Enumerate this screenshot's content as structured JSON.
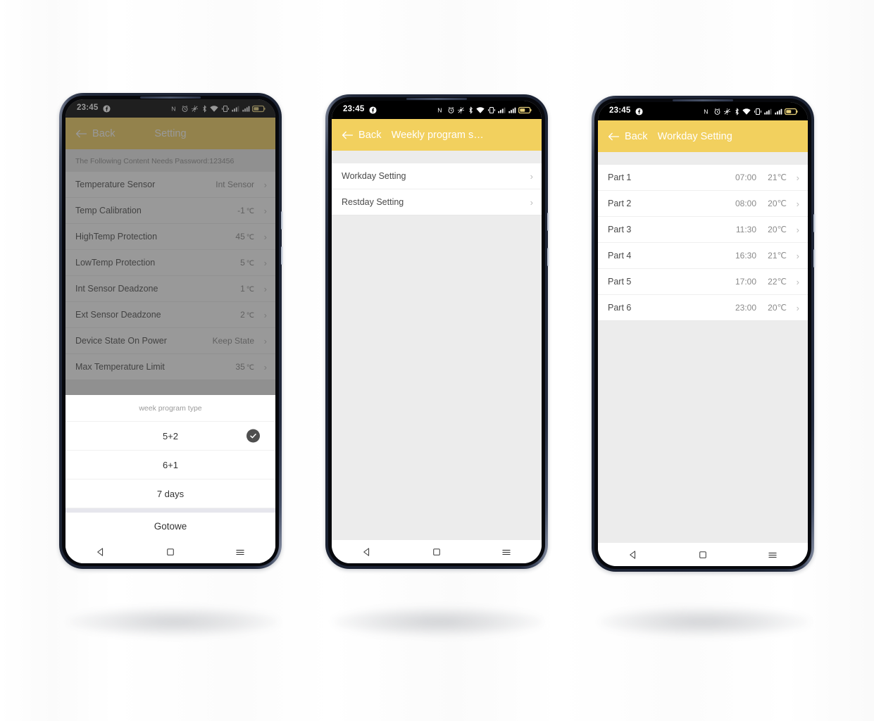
{
  "canvas": {
    "background_color": "#fdfdfd"
  },
  "theme": {
    "accent_yellow": "#f2d05e",
    "accent_yellow_dimmed": "#8a7431",
    "bezel_dark": "#1b2233",
    "list_bg": "#ffffff",
    "page_bg": "#ececec",
    "label_color": "#4a4a4a",
    "value_color": "#8a8a8a"
  },
  "status_bar": {
    "time": "23:45",
    "icons_left": [
      "facebook-icon"
    ],
    "icons_right": [
      "nfc-icon",
      "alarm-icon",
      "location-off-icon",
      "bluetooth-icon",
      "wifi-icon",
      "vibrate-icon",
      "signal-sim1-icon",
      "signal-sim2-icon",
      "battery-icon"
    ]
  },
  "nav_bar": {
    "back_label": "back-triangle-icon",
    "home_label": "home-square-icon",
    "recents_label": "menu-lines-icon"
  },
  "phone1": {
    "appbar": {
      "back_label": "Back",
      "title": "Setting",
      "back_icon": "arrow-left-icon"
    },
    "password_note": "The Following Content Needs Password:123456",
    "settings_rows": [
      {
        "label": "Temperature Sensor",
        "value": "Int Sensor",
        "unit": ""
      },
      {
        "label": "Temp Calibration",
        "value": "-1",
        "unit": "℃"
      },
      {
        "label": "HighTemp Protection",
        "value": "45",
        "unit": "℃"
      },
      {
        "label": "LowTemp Protection",
        "value": "5",
        "unit": "℃"
      },
      {
        "label": "Int Sensor Deadzone",
        "value": "1",
        "unit": "℃"
      },
      {
        "label": "Ext Sensor Deadzone",
        "value": "2",
        "unit": "℃"
      },
      {
        "label": "Device State On Power",
        "value": "Keep State",
        "unit": ""
      },
      {
        "label": "Max Temperature Limit",
        "value": "35",
        "unit": "℃"
      }
    ],
    "sheet": {
      "title": "week program type",
      "options": [
        {
          "label": "5+2",
          "selected": true
        },
        {
          "label": "6+1",
          "selected": false
        },
        {
          "label": "7 days",
          "selected": false
        }
      ],
      "done_label": "Gotowe",
      "check_icon": "check-icon"
    }
  },
  "phone2": {
    "appbar": {
      "back_label": "Back",
      "title": "Weekly program s…",
      "back_icon": "arrow-left-icon"
    },
    "rows": [
      {
        "label": "Workday Setting"
      },
      {
        "label": "Restday Setting"
      }
    ]
  },
  "phone3": {
    "appbar": {
      "back_label": "Back",
      "title": "Workday Setting",
      "back_icon": "arrow-left-icon"
    },
    "rows": [
      {
        "label": "Part 1",
        "time": "07:00",
        "temp": "21℃"
      },
      {
        "label": "Part 2",
        "time": "08:00",
        "temp": "20℃"
      },
      {
        "label": "Part 3",
        "time": "11:30",
        "temp": "20℃"
      },
      {
        "label": "Part 4",
        "time": "16:30",
        "temp": "21℃"
      },
      {
        "label": "Part 5",
        "time": "17:00",
        "temp": "22℃"
      },
      {
        "label": "Part 6",
        "time": "23:00",
        "temp": "20℃"
      }
    ]
  }
}
